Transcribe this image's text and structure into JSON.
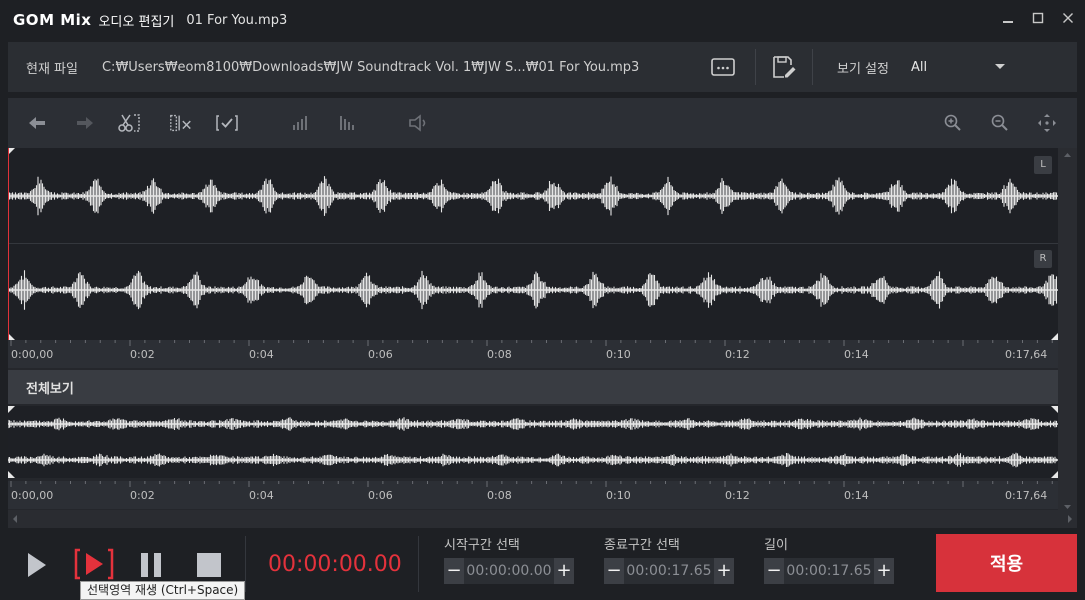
{
  "window": {
    "logo": "GOM Mix",
    "app_name": "오디오 편집기",
    "file_title": "01 For You.mp3",
    "controls": [
      "minimize-icon",
      "maximize-icon",
      "close-icon"
    ]
  },
  "filebar": {
    "current_file_label": "현재 파일",
    "path": "C:₩Users₩eom8100₩Downloads₩JW Soundtrack Vol. 1₩JW S...₩01 For You.mp3",
    "view_settings_label": "보기 설정",
    "view_select_value": "All"
  },
  "toolbar": {
    "icons": [
      "undo-icon",
      "redo-icon",
      "cut-icon",
      "delete-selection-icon",
      "select-all-icon",
      "fade-in-icon",
      "fade-out-icon",
      "volume-icon",
      "zoom-in-icon",
      "zoom-out-icon",
      "fit-icon"
    ]
  },
  "channels": {
    "left": "L",
    "right": "R"
  },
  "ruler": {
    "ticks": [
      "0:00,00",
      "0:02",
      "0:04",
      "0:06",
      "0:08",
      "0:10",
      "0:12",
      "0:14",
      "0:17,64"
    ]
  },
  "overview": {
    "label": "전체보기",
    "ticks": [
      "0:00,00",
      "0:02",
      "0:04",
      "0:06",
      "0:08",
      "0:10",
      "0:12",
      "0:14",
      "0:17,64"
    ]
  },
  "playback": {
    "time": "00:00:00.00",
    "tooltip": "선택영역 재생 (Ctrl+Space)"
  },
  "selection": {
    "start_label": "시작구간 선택",
    "start_value": "00:00:00.00",
    "end_label": "종료구간 선택",
    "end_value": "00:00:17.65",
    "length_label": "길이",
    "length_value": "00:00:17.65"
  },
  "apply_label": "적용",
  "colors": {
    "accent_red": "#d7323b",
    "time_red": "#e4323c",
    "background": "#1e2024",
    "wave": "#e6e6e6"
  }
}
